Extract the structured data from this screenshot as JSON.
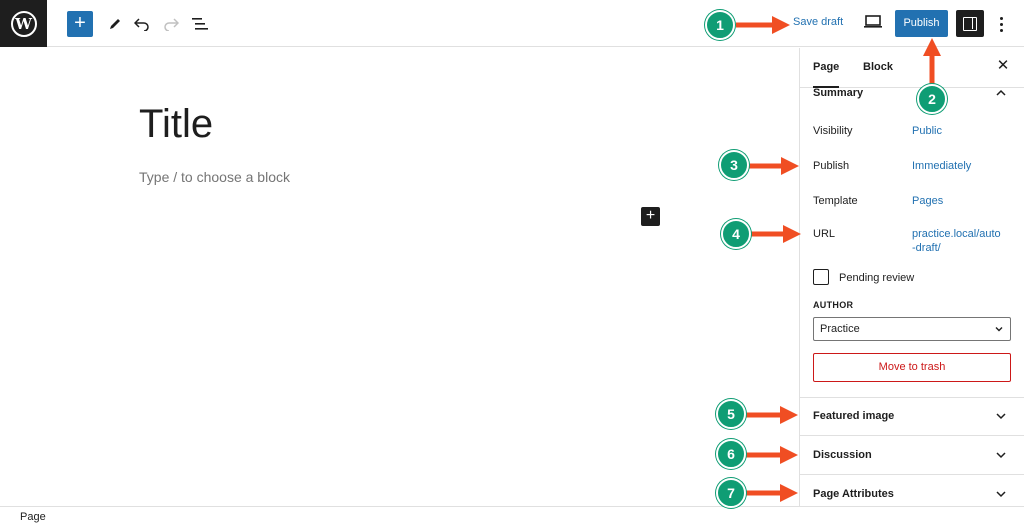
{
  "toolbar": {
    "logo_icon": "wordpress-logo",
    "add_block_icon": "plus-icon",
    "tools_icon": "pencil-icon",
    "undo_icon": "undo-icon",
    "redo_icon": "redo-icon",
    "list_view_icon": "list-view-icon",
    "save_draft_label": "Save draft",
    "preview_icon": "desktop-icon",
    "publish_label": "Publish",
    "settings_icon": "sidebar-toggle-icon",
    "options_icon": "more-vertical-icon"
  },
  "editor": {
    "title": "Title",
    "placeholder": "Type / to choose a block"
  },
  "sidebar": {
    "tabs": [
      {
        "label": "Page",
        "active": true
      },
      {
        "label": "Block",
        "active": false
      }
    ],
    "summary": {
      "title": "Summary",
      "rows": [
        {
          "label": "Visibility",
          "value": "Public"
        },
        {
          "label": "Publish",
          "value": "Immediately"
        },
        {
          "label": "Template",
          "value": "Pages"
        },
        {
          "label": "URL",
          "value": "practice.local/auto\n-draft/"
        }
      ],
      "pending_review_label": "Pending review",
      "pending_review_checked": false,
      "author_label": "AUTHOR",
      "author_value": "Practice",
      "trash_label": "Move to trash"
    },
    "panels": [
      {
        "title": "Featured image"
      },
      {
        "title": "Discussion"
      },
      {
        "title": "Page Attributes"
      }
    ]
  },
  "footer": {
    "breadcrumb": "Page"
  },
  "annotations": {
    "color_badge": "#0f9d74",
    "color_arrow": "#f04e23",
    "badges": [
      "1",
      "2",
      "3",
      "4",
      "5",
      "6",
      "7"
    ]
  },
  "colors": {
    "accent": "#2271b1",
    "danger": "#cc1818",
    "dark": "#1e1e1e"
  }
}
